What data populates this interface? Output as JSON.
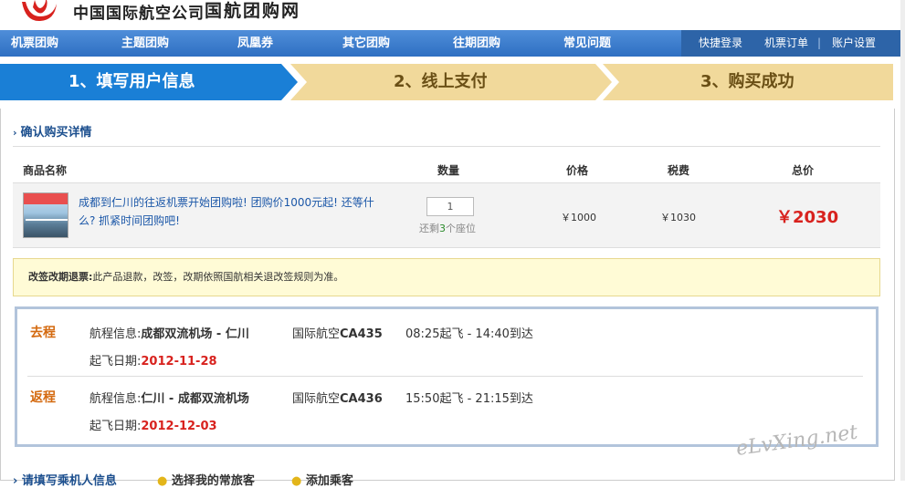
{
  "header": {
    "company_name": "中国国际航空公司",
    "site_name": "国航团购网"
  },
  "nav": {
    "items": [
      "机票团购",
      "主题团购",
      "凤凰券",
      "其它团购",
      "往期团购",
      "常见问题"
    ],
    "right": {
      "quick_login": "快捷登录",
      "orders": "机票订单",
      "sep": "|",
      "account": "账户设置"
    }
  },
  "steps": [
    {
      "label": "1、填写用户信息",
      "active": true
    },
    {
      "label": "2、线上支付",
      "active": false
    },
    {
      "label": "3、购买成功",
      "active": false
    }
  ],
  "confirm": {
    "title": "确认购买详情",
    "columns": [
      "商品名称",
      "数量",
      "价格",
      "税费",
      "总价"
    ],
    "product": {
      "description": "成都到仁川的往返机票开始团购啦! 团购价1000元起! 还等什么? 抓紧时间团购吧!",
      "quantity": "1",
      "seats_prefix": "还剩",
      "seats_count": "3",
      "seats_suffix": "个座位",
      "price": "￥1000",
      "tax": "￥1030",
      "total": "￥2030"
    }
  },
  "notice": {
    "label": "改签改期退票:",
    "text": "此产品退款，改签，改期依照国航相关退改签规则为准。"
  },
  "flights": [
    {
      "label": "去程",
      "route_prefix": "航程信息:",
      "route": "成都双流机场  - 仁川",
      "flight_prefix": "国际航空",
      "flight_no": "CA435",
      "times": "08:25起飞 - 14:40到达",
      "date_prefix": "起飞日期:",
      "date": "2012-11-28"
    },
    {
      "label": "返程",
      "route_prefix": "航程信息:",
      "route": "仁川  - 成都双流机场",
      "flight_prefix": "国际航空",
      "flight_no": "CA436",
      "times": "15:50起飞 - 21:15到达",
      "date_prefix": "起飞日期:",
      "date": "2012-12-03"
    }
  ],
  "bottom": {
    "fill_info": "请填写乘机人信息",
    "choose_frequent": "选择我的常旅客",
    "add_passenger": "添加乘客"
  },
  "watermark": "eLvXing.net",
  "colors": {
    "nav_blue": "#2e6fc2",
    "step_active": "#1a7fd6",
    "step_inactive": "#f1d99b",
    "total_red": "#d8221e",
    "flight_label": "#d46a10"
  }
}
